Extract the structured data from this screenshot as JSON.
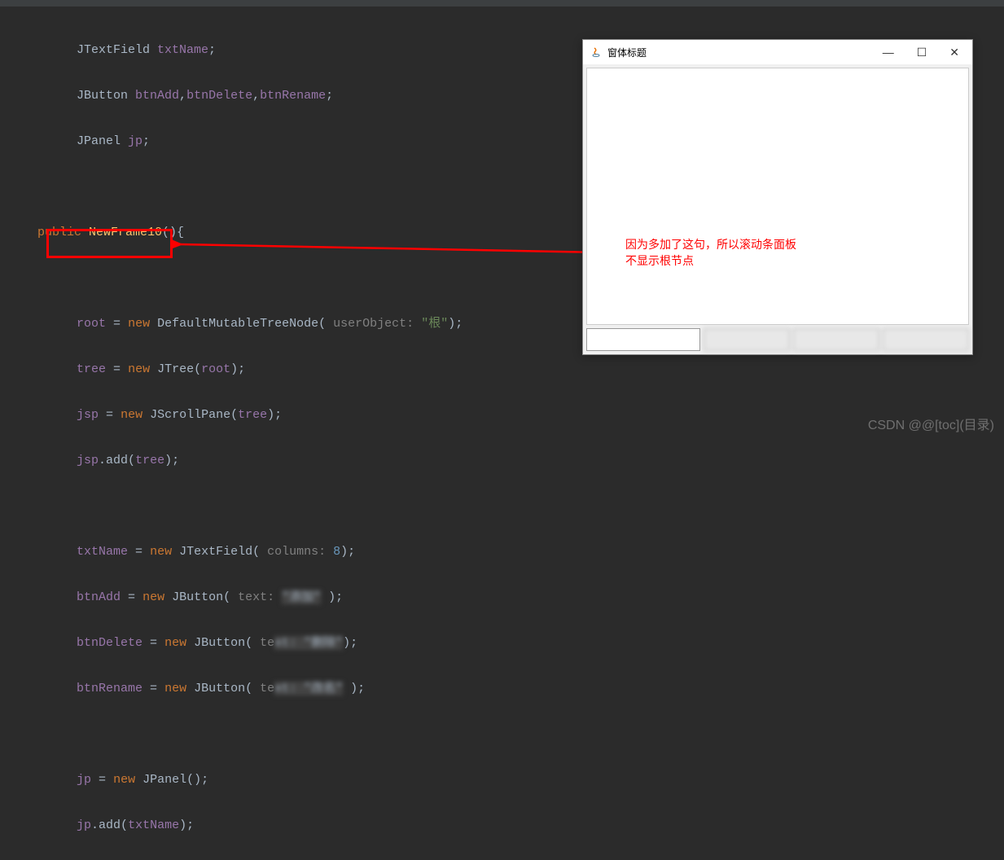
{
  "code": {
    "l1_type": "JTextField",
    "l1_field": "txtName",
    "l2_type": "JButton",
    "l2_f1": "btnAdd",
    "l2_f2": "btnDelete",
    "l2_f3": "btnRename",
    "l3_type": "JPanel",
    "l3_field": "jp",
    "l4_kw": "public",
    "l4_method": "NewFrame10",
    "l5_field": "root",
    "l5_kw": "new",
    "l5_type": "DefaultMutableTreeNode",
    "l5_param": "userObject:",
    "l5_str": "\"根\"",
    "l6_field": "tree",
    "l6_kw": "new",
    "l6_type": "JTree",
    "l6_arg": "root",
    "l7_field": "jsp",
    "l7_kw": "new",
    "l7_type": "JScrollPane",
    "l7_arg": "tree",
    "l8_field": "jsp",
    "l8_method": "add",
    "l8_arg": "tree",
    "l9_field": "txtName",
    "l9_kw": "new",
    "l9_type": "JTextField",
    "l9_param": "columns:",
    "l9_num": "8",
    "l10_field": "btnAdd",
    "l10_kw": "new",
    "l10_type": "JButton",
    "l10_param": "text:",
    "l11_field": "btnDelete",
    "l11_kw": "new",
    "l11_type": "JButton",
    "l11_param": "te",
    "l12_field": "btnRename",
    "l12_kw": "new",
    "l12_type": "JButton",
    "l12_param": "te",
    "l13_field": "jp",
    "l13_kw": "new",
    "l13_type": "JPanel",
    "l14_field": "jp",
    "l14_method": "add",
    "l14_arg": "txtName"
  },
  "window": {
    "title": "窗体标题",
    "minimize": "—",
    "maximize": "☐",
    "close": "✕"
  },
  "annotation": {
    "line1": "因为多加了这句，所以滚动条面板",
    "line2": "不显示根节点"
  },
  "watermark": "CSDN @@[toc](目录)"
}
